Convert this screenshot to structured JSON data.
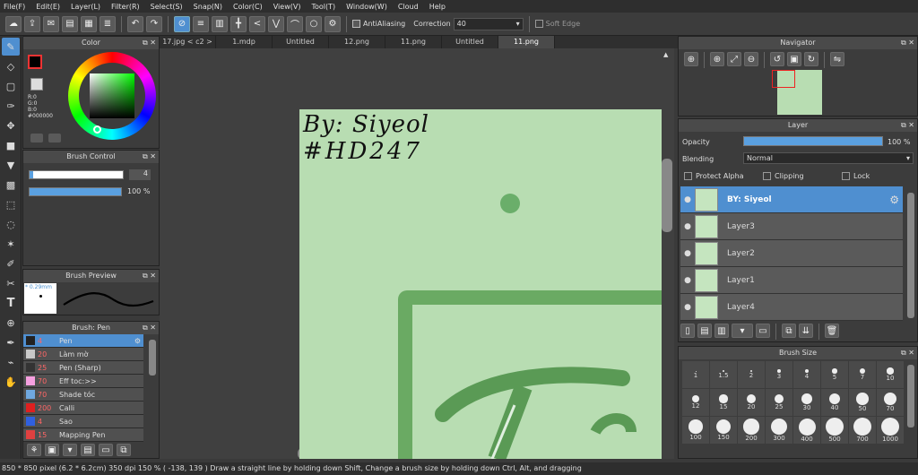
{
  "menu": [
    "File(F)",
    "Edit(E)",
    "Layer(L)",
    "Filter(R)",
    "Select(S)",
    "Snap(N)",
    "Color(C)",
    "View(V)",
    "Tool(T)",
    "Window(W)",
    "Cloud",
    "Help"
  ],
  "toolbar": {
    "antialias": "AntiAliasing",
    "correction_label": "Correction",
    "correction_value": "40",
    "softedge": "Soft Edge"
  },
  "tabs": [
    "17.jpg < c2 >",
    "1.mdp",
    "Untitled",
    "12.png",
    "11.png",
    "Untitled",
    "11.png"
  ],
  "color_panel": {
    "title": "Color",
    "r": "R:0",
    "g": "G:0",
    "b": "B:0",
    "hex": "#000000"
  },
  "brush_control": {
    "title": "Brush Control",
    "size": "4",
    "opacity": "100 %"
  },
  "brush_preview": {
    "title": "Brush Preview",
    "size": "* 0.29mm"
  },
  "brush_list": {
    "title": "Brush: Pen",
    "items": [
      {
        "size": "4",
        "name": "Pen",
        "color": "#222222",
        "sel": true
      },
      {
        "size": "20",
        "name": "Làm mờ",
        "color": "#c8c8c8"
      },
      {
        "size": "25",
        "name": "Pen (Sharp)",
        "color": "#333333"
      },
      {
        "size": "70",
        "name": "Eff toc:>>",
        "color": "#f5a0e0"
      },
      {
        "size": "70",
        "name": "Shade tóc",
        "color": "#6fa8e0"
      },
      {
        "size": "200",
        "name": "Calli",
        "color": "#e02020"
      },
      {
        "size": "4",
        "name": "Sao",
        "color": "#3060e0"
      },
      {
        "size": "15",
        "name": "Mapping Pen",
        "color": "#e04040"
      }
    ]
  },
  "canvas": {
    "text_line1": "By: Siyeol",
    "text_line2": "#HD247"
  },
  "navigator": {
    "title": "Navigator"
  },
  "layer_panel": {
    "title": "Layer",
    "opacity_label": "Opacity",
    "opacity_value": "100 %",
    "blending_label": "Blending",
    "blending_value": "Normal",
    "protect_alpha": "Protect Alpha",
    "clipping": "Clipping",
    "lock": "Lock",
    "layers": [
      {
        "name": "BY: Siyeol",
        "sel": true
      },
      {
        "name": "Layer3"
      },
      {
        "name": "Layer2"
      },
      {
        "name": "Layer1"
      },
      {
        "name": "Layer4"
      }
    ]
  },
  "brush_size": {
    "title": "Brush Size",
    "sizes": [
      "1",
      "1.5",
      "2",
      "3",
      "4",
      "5",
      "7",
      "10",
      "12",
      "15",
      "20",
      "25",
      "30",
      "40",
      "50",
      "70",
      "100",
      "150",
      "200",
      "300",
      "400",
      "500",
      "700",
      "1000"
    ]
  },
  "status": {
    "dims": "850 * 850 pixel",
    "cm": "(6.2 * 6.2cm)",
    "dpi": "350 dpi",
    "zoom": "150 %",
    "coords": "( -138, 139 )",
    "hint": "Draw a straight line by holding down Shift, Change a brush size by holding down Ctrl, Alt, and dragging"
  }
}
